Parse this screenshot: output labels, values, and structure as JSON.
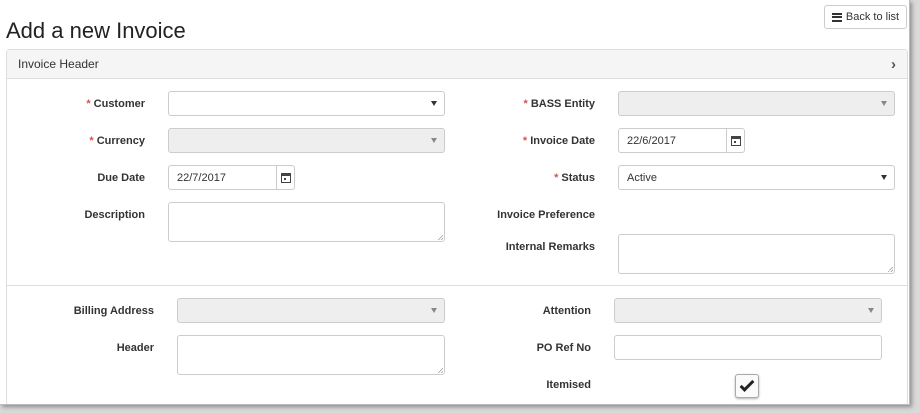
{
  "page": {
    "title": "Add a new Invoice",
    "back_label": "Back to list"
  },
  "panel": {
    "heading": "Invoice Header"
  },
  "fields": {
    "customer": {
      "label": "Customer",
      "value": ""
    },
    "bass_entity": {
      "label": "BASS Entity",
      "value": ""
    },
    "currency": {
      "label": "Currency",
      "value": ""
    },
    "invoice_date": {
      "label": "Invoice Date",
      "value": "22/6/2017"
    },
    "due_date": {
      "label": "Due Date",
      "value": "22/7/2017"
    },
    "status": {
      "label": "Status",
      "value": "Active"
    },
    "description": {
      "label": "Description"
    },
    "invoice_preference": {
      "label": "Invoice Preference"
    },
    "internal_remarks": {
      "label": "Internal Remarks"
    },
    "billing_address": {
      "label": "Billing Address",
      "value": ""
    },
    "attention": {
      "label": "Attention",
      "value": ""
    },
    "header": {
      "label": "Header"
    },
    "po_ref_no": {
      "label": "PO Ref No",
      "value": ""
    },
    "itemised": {
      "label": "Itemised",
      "checked": true
    }
  },
  "required_marker": "*"
}
